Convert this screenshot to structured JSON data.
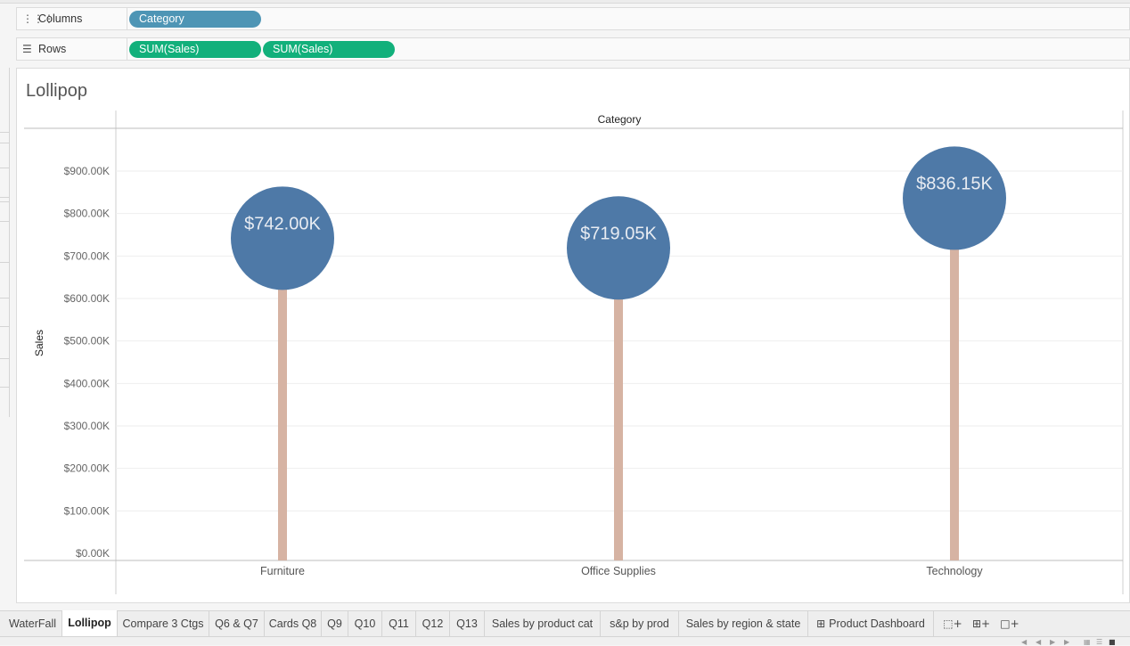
{
  "shelves": {
    "columns_label": "Columns",
    "rows_label": "Rows",
    "columns_icon": "columns-icon",
    "rows_icon": "rows-icon",
    "columns_pills": [
      "Category"
    ],
    "rows_pills": [
      "SUM(Sales)",
      "SUM(Sales)"
    ]
  },
  "worksheet": {
    "title": "Lollipop",
    "column_header": "Category",
    "y_axis_label": "Sales"
  },
  "colors": {
    "circle": "#4e79a7",
    "stick": "#d6b3a3",
    "pill_dimension": "#4e95b5",
    "pill_measure": "#12b07b"
  },
  "chart_data": {
    "type": "lollipop",
    "categories": [
      "Furniture",
      "Office Supplies",
      "Technology"
    ],
    "series": [
      {
        "values": [
          742000,
          719050,
          836150
        ]
      }
    ],
    "data_labels": [
      "$742.00K",
      "$719.05K",
      "$836.15K"
    ],
    "y_ticks": [
      {
        "value": 0,
        "label": "$0.00K"
      },
      {
        "value": 100000,
        "label": "$100.00K"
      },
      {
        "value": 200000,
        "label": "$200.00K"
      },
      {
        "value": 300000,
        "label": "$300.00K"
      },
      {
        "value": 400000,
        "label": "$400.00K"
      },
      {
        "value": 500000,
        "label": "$500.00K"
      },
      {
        "value": 600000,
        "label": "$600.00K"
      },
      {
        "value": 700000,
        "label": "$700.00K"
      },
      {
        "value": 800000,
        "label": "$800.00K"
      },
      {
        "value": 900000,
        "label": "$900.00K"
      }
    ],
    "ylim": [
      0,
      900000
    ],
    "xlabel": "Category",
    "ylabel": "Sales",
    "grid": true
  },
  "tabs": [
    {
      "label": "WaterFall",
      "active": false
    },
    {
      "label": "Lollipop",
      "active": true
    },
    {
      "label": "Compare 3 Ctgs",
      "active": false
    },
    {
      "label": "Q6 & Q7",
      "active": false
    },
    {
      "label": "Cards Q8",
      "active": false
    },
    {
      "label": "Q9",
      "active": false
    },
    {
      "label": "Q10",
      "active": false
    },
    {
      "label": "Q11",
      "active": false
    },
    {
      "label": "Q12",
      "active": false
    },
    {
      "label": "Q13",
      "active": false
    },
    {
      "label": "Sales by product cat",
      "active": false
    },
    {
      "label": "s&p by prod",
      "active": false
    },
    {
      "label": "Sales by region & state",
      "active": false
    },
    {
      "label": "Product Dashboard",
      "active": false,
      "icon": "dashboard-icon"
    }
  ],
  "tab_actions": [
    "new-worksheet-icon",
    "new-dashboard-icon",
    "new-story-icon"
  ]
}
